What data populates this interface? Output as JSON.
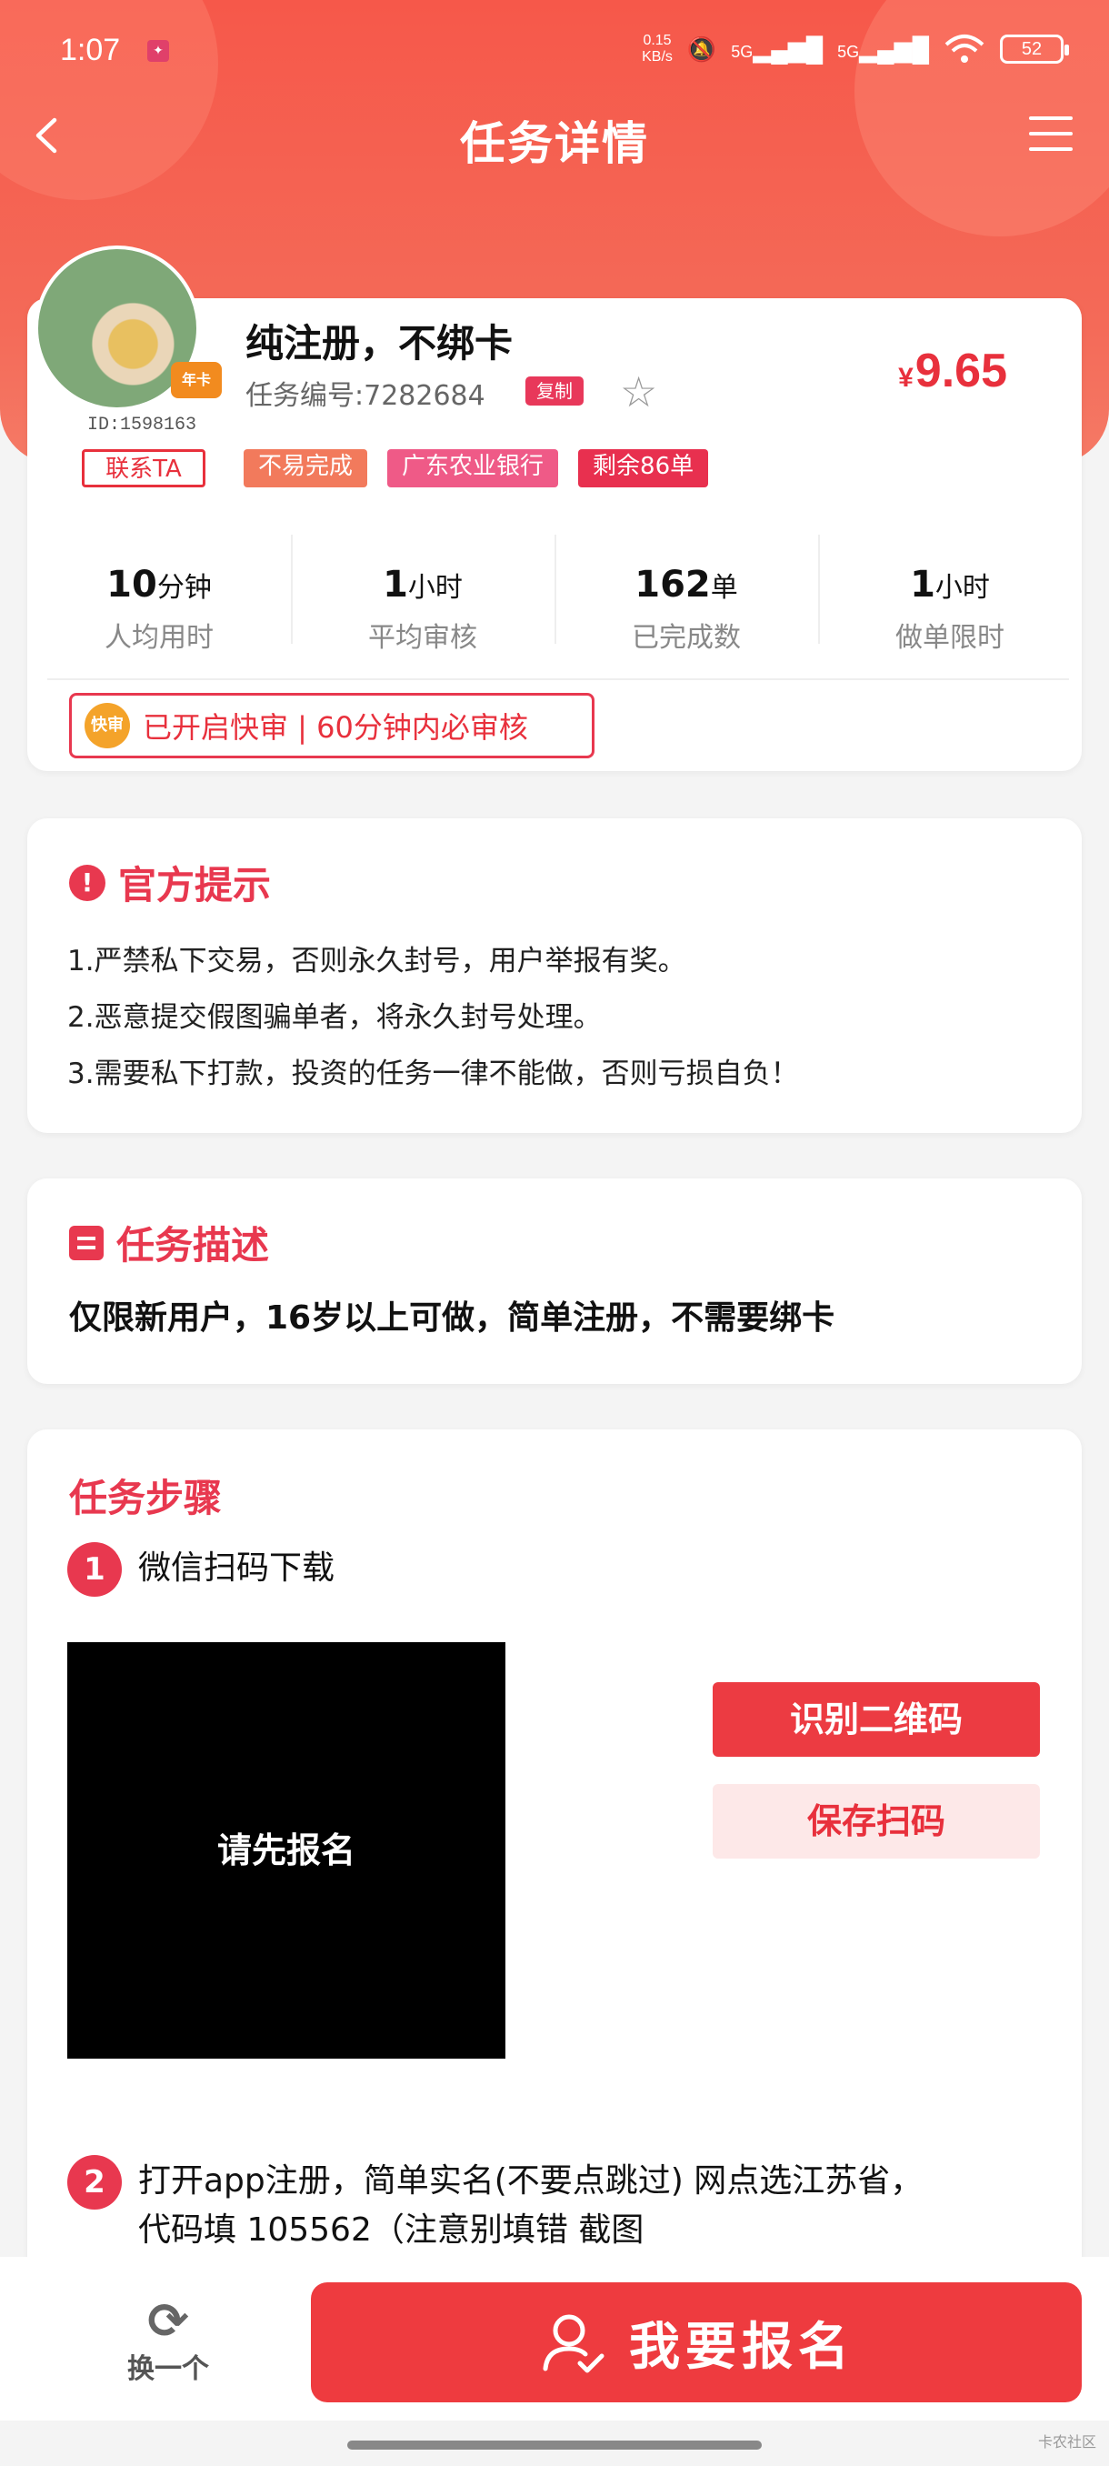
{
  "status_bar": {
    "time": "1:07",
    "speed_value": "0.15",
    "speed_unit": "KB/s",
    "signal_1": "5G",
    "signal_2": "5G",
    "battery": "52"
  },
  "nav": {
    "title": "任务详情"
  },
  "task": {
    "title": "纯注册，不绑卡",
    "number_label": "任务编号:7282684",
    "copy_label": "复制",
    "price_symbol": "¥",
    "price": "9.65",
    "user_id": "ID:1598163",
    "vip_badge": "年卡",
    "tags": [
      "联系TA",
      "不易完成",
      "广东农业银行",
      "剩余86单"
    ]
  },
  "stats": [
    {
      "value": "10",
      "unit": "分钟",
      "label": "人均用时"
    },
    {
      "value": "1",
      "unit": "小时",
      "label": "平均审核"
    },
    {
      "value": "162",
      "unit": "单",
      "label": "已完成数"
    },
    {
      "value": "1",
      "unit": "小时",
      "label": "做单限时"
    }
  ],
  "fast_review": {
    "icon_text": "快审",
    "text": "已开启快审 | 60分钟内必审核"
  },
  "official_tips": {
    "title": "官方提示",
    "lines": [
      "1.严禁私下交易，否则永久封号，用户举报有奖。",
      "2.恶意提交假图骗单者，将永久封号处理。",
      "3.需要私下打款，投资的任务一律不能做，否则亏损自负！"
    ]
  },
  "description": {
    "title": "任务描述",
    "text": "仅限新用户，16岁以上可做，简单注册，不需要绑卡"
  },
  "steps": {
    "title": "任务步骤",
    "items": [
      {
        "num": "1",
        "text": "微信扫码下载"
      },
      {
        "num": "2",
        "text_line1": "打开app注册，简单实名(不要点跳过) 网点选江苏省，",
        "text_line2": "代码填 105562（注意别填错 截图"
      }
    ],
    "qr_placeholder": "请先报名",
    "recognize_qr": "识别二维码",
    "save_qr": "保存扫码"
  },
  "bottom": {
    "swap_label": "换一个",
    "apply_label": "我要报名"
  },
  "watermark": "卡农社区",
  "colors": {
    "primary": "#e8384f",
    "accent_red": "#ee3b3f",
    "header_gradient": "#f6584a"
  }
}
